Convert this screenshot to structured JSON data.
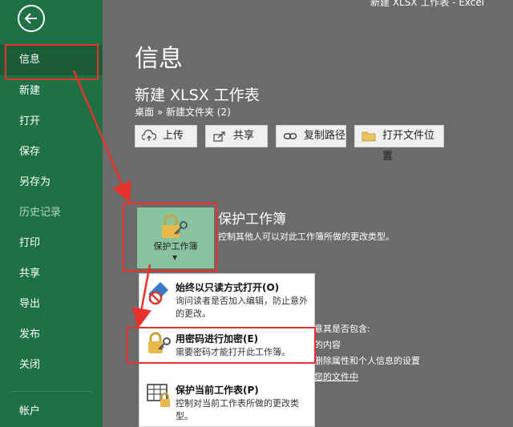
{
  "window": {
    "title": "新建 XLSX 工作表 - Excel"
  },
  "sidebar": {
    "items": [
      {
        "label": "信息",
        "active": true
      },
      {
        "label": "新建"
      },
      {
        "label": "打开"
      },
      {
        "label": "保存"
      },
      {
        "label": "另存为"
      },
      {
        "label": "历史记录"
      },
      {
        "label": "打印"
      },
      {
        "label": "共享"
      },
      {
        "label": "导出"
      },
      {
        "label": "发布"
      },
      {
        "label": "关闭"
      },
      {
        "label": "帐户"
      }
    ]
  },
  "main": {
    "page_title": "信息",
    "doc_title": "新建 XLSX 工作表",
    "breadcrumb": "桌面 » 新建文件夹 (2)",
    "toolbar": {
      "upload": "上传",
      "share": "共享",
      "copy_path": "复制路径",
      "open_location": "打开文件位置"
    },
    "protect": {
      "tile_label": "保护工作簿",
      "title": "保护工作簿",
      "description": "控制其他人可以对此工作簿所做的更改类型。"
    },
    "inspect_partial": {
      "line1": "意其是否包含:",
      "line2": "的内容",
      "line3": "删除属性和个人信息的设置",
      "line4": "您的文件中"
    },
    "dropdown": {
      "items": [
        {
          "title": "始终以只读方式打开(O)",
          "description": "询问读者是否加入编辑，防止意外的更改。",
          "icon": "readonly-pencil-icon"
        },
        {
          "title": "用密码进行加密(E)",
          "description": "需要密码才能打开此工作簿。",
          "icon": "lock-key-icon"
        },
        {
          "title": "保护当前工作表(P)",
          "description": "控制对当前工作表所做的更改类型。",
          "icon": "sheet-lock-icon"
        }
      ]
    }
  },
  "colors": {
    "sidebar_bg": "#1e7145",
    "main_bg": "#6b6b6b",
    "annotation_red": "#e8322c",
    "tile_bg": "#88c4a0"
  }
}
